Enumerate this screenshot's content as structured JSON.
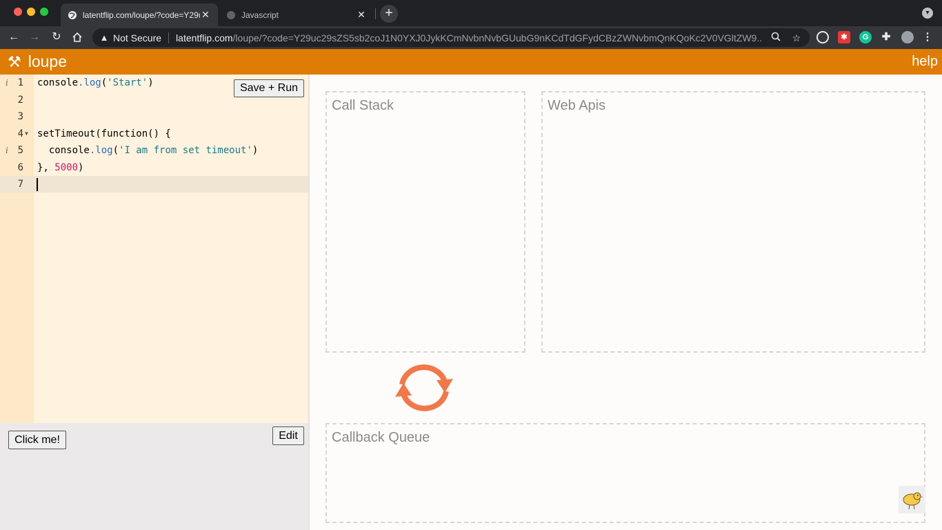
{
  "browser": {
    "tabs": [
      {
        "title": "latentflip.com/loupe/?code=Y29uc29s",
        "active": true
      },
      {
        "title": "Javascript",
        "active": false
      }
    ],
    "security_label": "Not Secure",
    "url_host": "latentflip.com",
    "url_path": "/loupe/?code=Y29uc29sZS5sb2coJ1N0YXJ0JykKCmNvbnNvbGUubG9nKCdTdGFydCBzZWNvbmQnKQoKc2V0VGltZW9...",
    "icons": [
      "back-icon",
      "forward-icon",
      "reload-icon",
      "home-icon",
      "zoom-icon",
      "star-icon",
      "extension-icon",
      "profile-avatar"
    ]
  },
  "app": {
    "name": "loupe",
    "help_label": "help",
    "accent_color": "#de7c05"
  },
  "editor": {
    "save_run_label": "Save + Run",
    "lines": [
      {
        "num": "1",
        "info": true,
        "fold": false
      },
      {
        "num": "2",
        "info": false,
        "fold": false
      },
      {
        "num": "3",
        "info": false,
        "fold": false
      },
      {
        "num": "4",
        "info": false,
        "fold": true
      },
      {
        "num": "5",
        "info": true,
        "fold": false
      },
      {
        "num": "6",
        "info": false,
        "fold": false
      },
      {
        "num": "7",
        "info": false,
        "fold": false
      }
    ],
    "code": {
      "l1a": "console",
      "l1b": ".log",
      "l1c": "(",
      "l1d": "'Start'",
      "l1e": ")",
      "l4": "setTimeout(function() {",
      "l5a": "  console",
      "l5b": ".log",
      "l5c": "(",
      "l5d": "'I am from set timeout'",
      "l5e": ")",
      "l6a": "}, ",
      "l6b": "5000",
      "l6c": ")"
    },
    "active_line": "7"
  },
  "output": {
    "click_label": "Click me!",
    "edit_label": "Edit"
  },
  "visualizer": {
    "call_stack_label": "Call Stack",
    "web_apis_label": "Web Apis",
    "callback_queue_label": "Callback Queue",
    "loop_color": "#f0784a"
  }
}
